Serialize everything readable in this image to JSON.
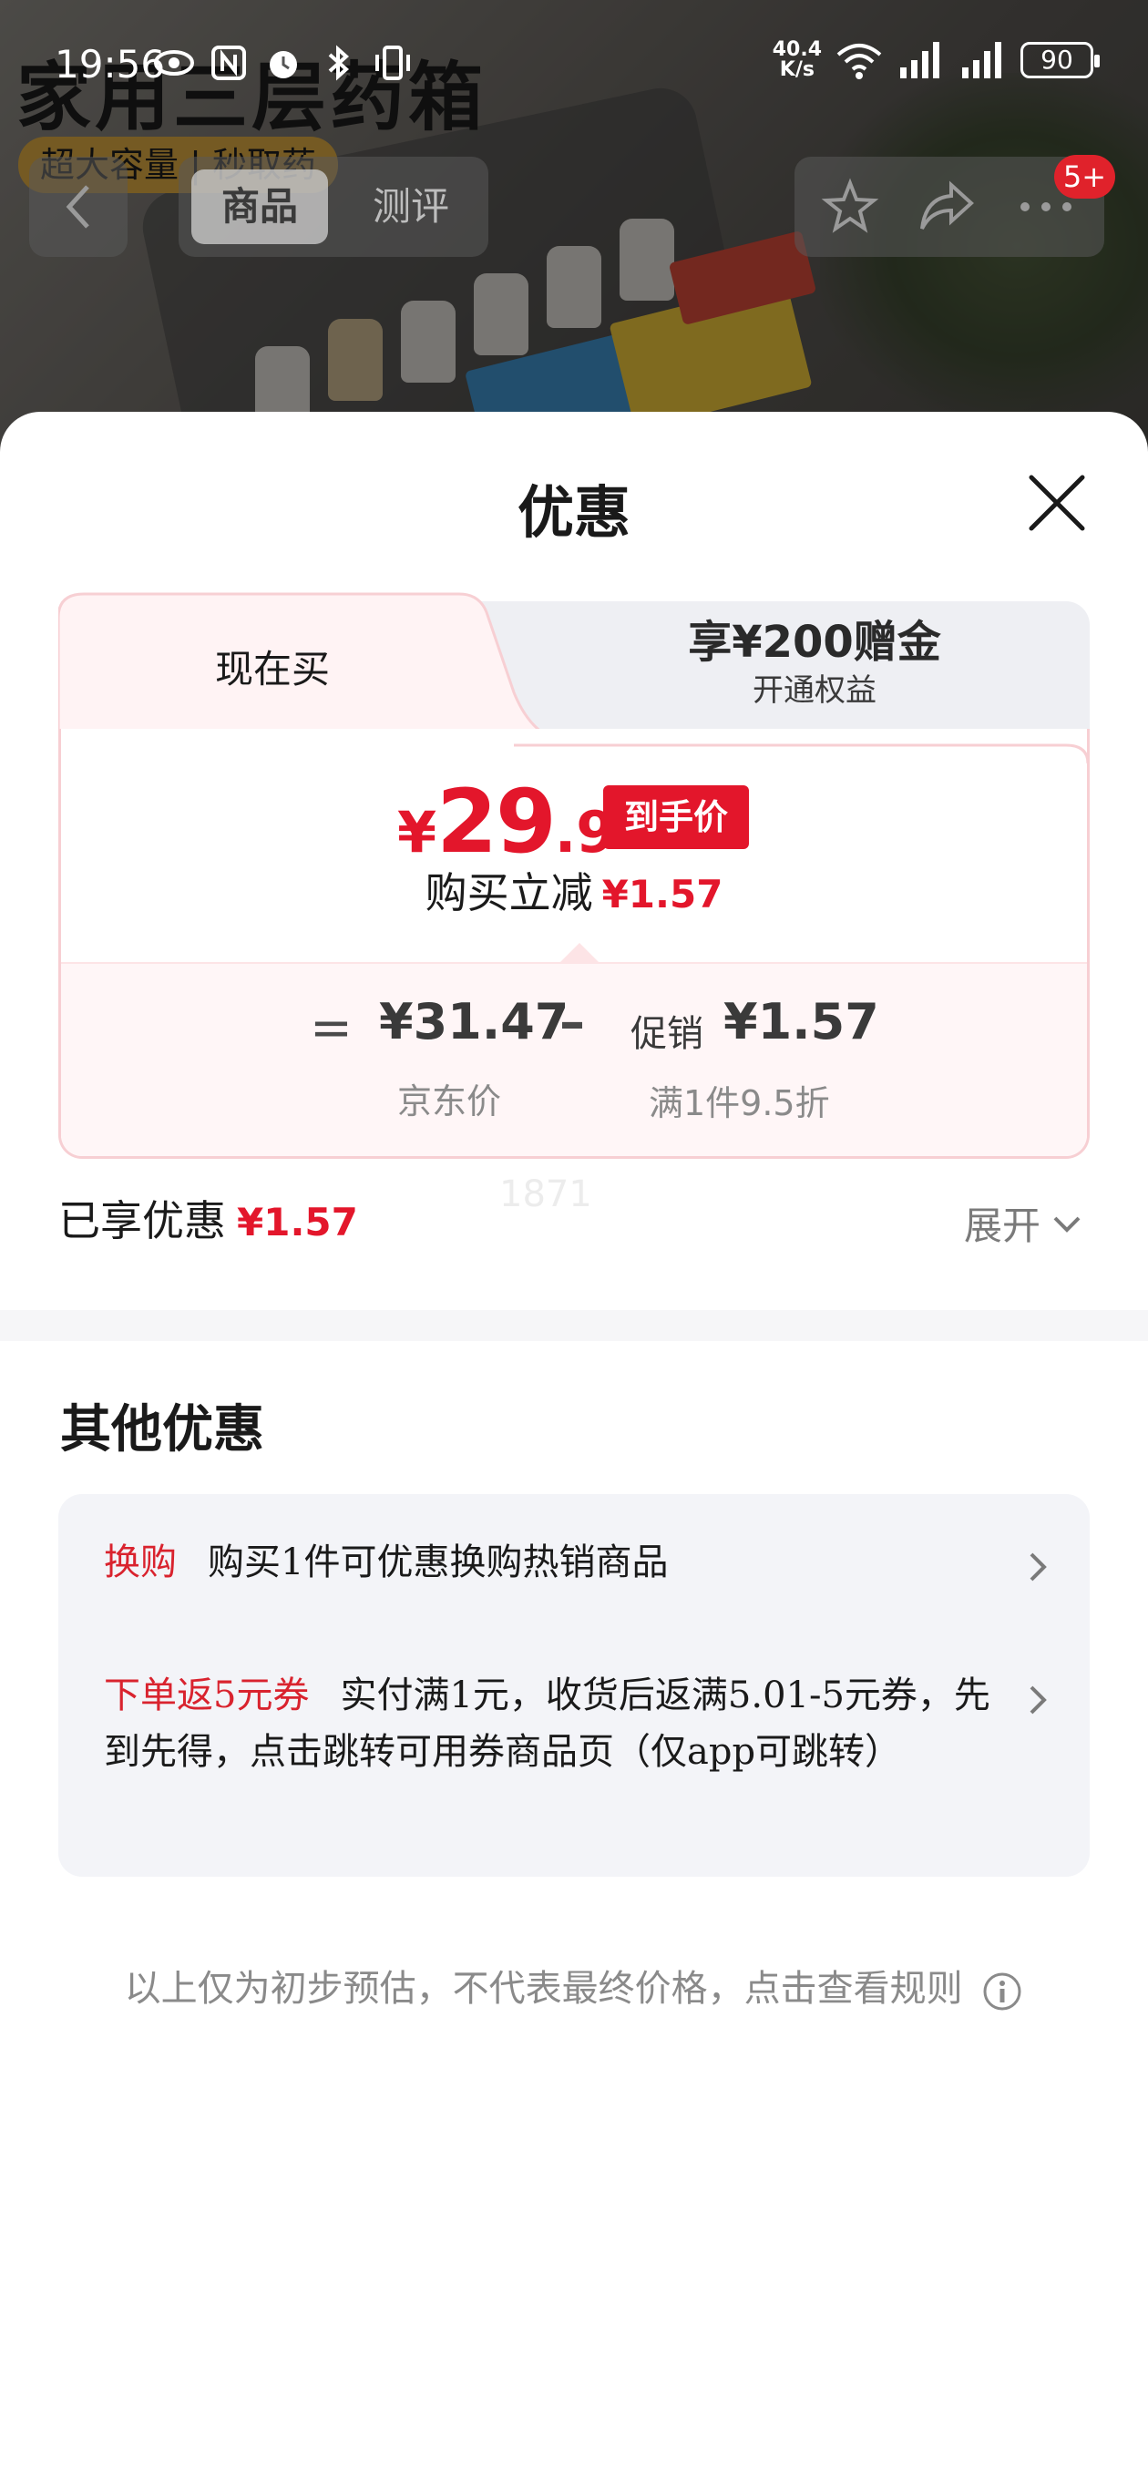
{
  "status_bar": {
    "time": "19:56",
    "net_speed_top": "40.4",
    "net_speed_bottom": "K/s",
    "battery": "90"
  },
  "product_header": {
    "title": "家用三层药箱",
    "subtitle": "超大容量 | 秒取药",
    "tabs": [
      "商品",
      "测评"
    ],
    "badge": "5+"
  },
  "sheet": {
    "title": "优惠",
    "tab_now": "现在买",
    "tab_gift_title": "享¥200赠金",
    "tab_gift_sub": "开通权益",
    "final_price_currency": "¥",
    "final_price_int": "29",
    "final_price_dec": ".9",
    "final_price_tag": "到手价",
    "save_label": "购买立减",
    "save_amount": "¥1.57",
    "equals": "=",
    "jd_price": "¥31.47",
    "jd_label": "京东价",
    "minus": "–",
    "promo_label": "促销",
    "promo_amount": "¥1.57",
    "promo_rule": "满1件9.5折",
    "enjoyed_label": "已享优惠",
    "enjoyed_amount": "¥1.57",
    "watermark": "1871",
    "expand_label": "展开",
    "other_title": "其他优惠",
    "offers": [
      {
        "tag": "换购",
        "text": "购买1件可优惠换购热销商品"
      },
      {
        "tag": "下单返5元券",
        "text": "实付满1元，收货后返满5.01-5元券，先到先得，点击跳转可用券商品页（仅app可跳转）"
      }
    ],
    "footnote": "以上仅为初步预估，不代表最终价格，点击查看规则"
  },
  "colors": {
    "accent_red": "#e3162b",
    "card_border": "#f7cfd3",
    "offers_bg": "#f3f4f8"
  }
}
